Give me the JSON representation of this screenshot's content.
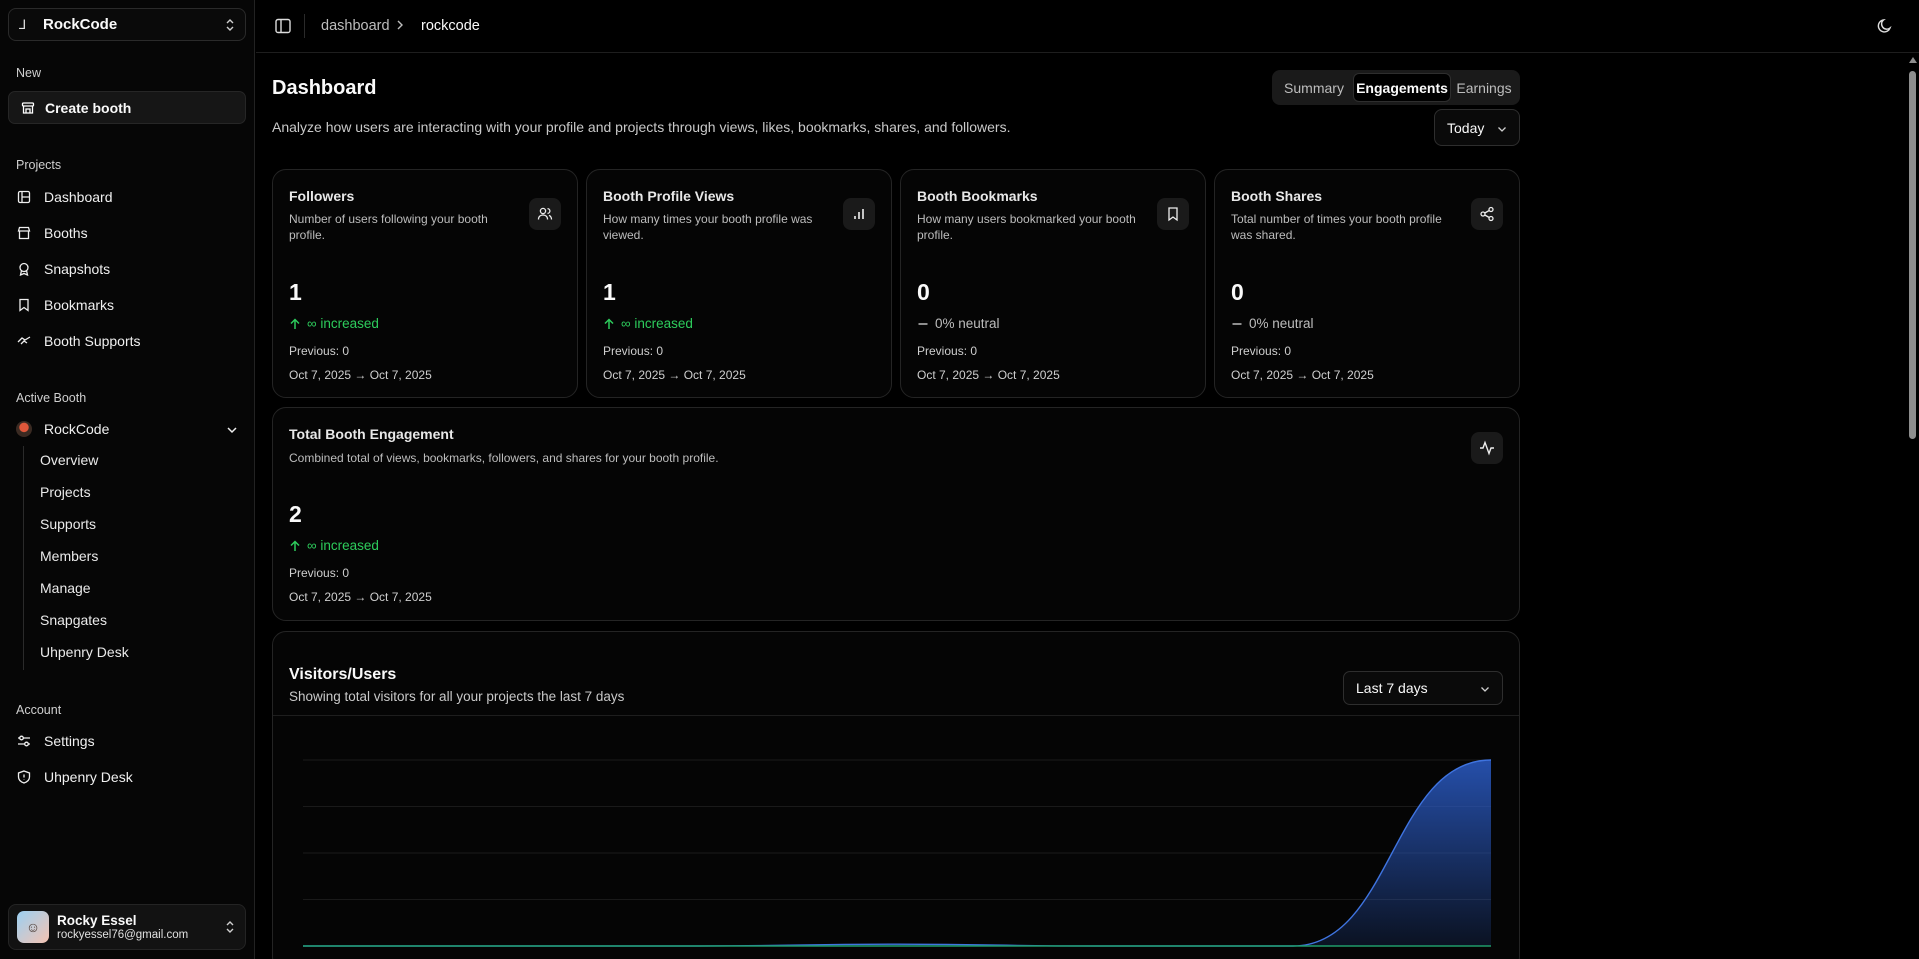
{
  "sidebar": {
    "team_name": "RockCode",
    "new_label": "New",
    "create_booth": "Create booth",
    "projects_label": "Projects",
    "projects_items": [
      "Dashboard",
      "Booths",
      "Snapshots",
      "Bookmarks",
      "Booth Supports"
    ],
    "active_booth_label": "Active Booth",
    "active_booth_name": "RockCode",
    "booth_subitems": [
      "Overview",
      "Projects",
      "Supports",
      "Members",
      "Manage",
      "Snapgates",
      "Uhpenry Desk"
    ],
    "account_label": "Account",
    "account_items": [
      "Settings",
      "Uhpenry Desk"
    ],
    "user": {
      "name": "Rocky Essel",
      "email": "rockyessel76@gmail.com"
    }
  },
  "topbar": {
    "breadcrumb": [
      "dashboard",
      "rockcode"
    ]
  },
  "main": {
    "title": "Dashboard",
    "description": "Analyze how users are interacting with your profile and projects through views, likes, bookmarks, shares, and followers.",
    "tabs": [
      "Summary",
      "Engagements",
      "Earnings"
    ],
    "active_tab": "Engagements",
    "range": "Today"
  },
  "stats": [
    {
      "title": "Followers",
      "desc": "Number of users following your booth profile.",
      "value": "1",
      "trend": "∞ increased",
      "trend_type": "up",
      "previous": "Previous: 0",
      "dates": "Oct 7, 2025 → Oct 7, 2025",
      "icon": "users-icon"
    },
    {
      "title": "Booth Profile Views",
      "desc": "How many times your booth profile was viewed.",
      "value": "1",
      "trend": "∞ increased",
      "trend_type": "up",
      "previous": "Previous: 0",
      "dates": "Oct 7, 2025 → Oct 7, 2025",
      "icon": "bar-chart-icon"
    },
    {
      "title": "Booth Bookmarks",
      "desc": "How many users bookmarked your booth profile.",
      "value": "0",
      "trend": "0% neutral",
      "trend_type": "neutral",
      "previous": "Previous: 0",
      "dates": "Oct 7, 2025 → Oct 7, 2025",
      "icon": "bookmark-icon"
    },
    {
      "title": "Booth Shares",
      "desc": "Total number of times your booth profile was shared.",
      "value": "0",
      "trend": "0% neutral",
      "trend_type": "neutral",
      "previous": "Previous: 0",
      "dates": "Oct 7, 2025 → Oct 7, 2025",
      "icon": "share-icon"
    }
  ],
  "total": {
    "title": "Total Booth Engagement",
    "desc": "Combined total of views, bookmarks, followers, and shares for your booth profile.",
    "value": "2",
    "trend": "∞ increased",
    "previous": "Previous: 0",
    "dates": "Oct 7, 2025 → Oct 7, 2025",
    "icon": "activity-icon"
  },
  "visitors": {
    "title": "Visitors/Users",
    "desc": "Showing total visitors for all your projects the last 7 days",
    "range": "Last 7 days"
  },
  "colors": {
    "accent_up": "#2dcc5c",
    "chart_blue": "#2b5cc7",
    "chart_green": "#1f9b6a"
  },
  "chart_data": {
    "type": "area",
    "x": [
      1,
      2,
      3,
      4,
      5,
      6,
      7
    ],
    "series": [
      {
        "values": [
          0,
          0,
          0,
          0.02,
          0,
          0,
          2
        ]
      },
      {
        "values": [
          0,
          0,
          0,
          0,
          0,
          0,
          0
        ]
      }
    ],
    "ylim": [
      0,
      2
    ]
  }
}
